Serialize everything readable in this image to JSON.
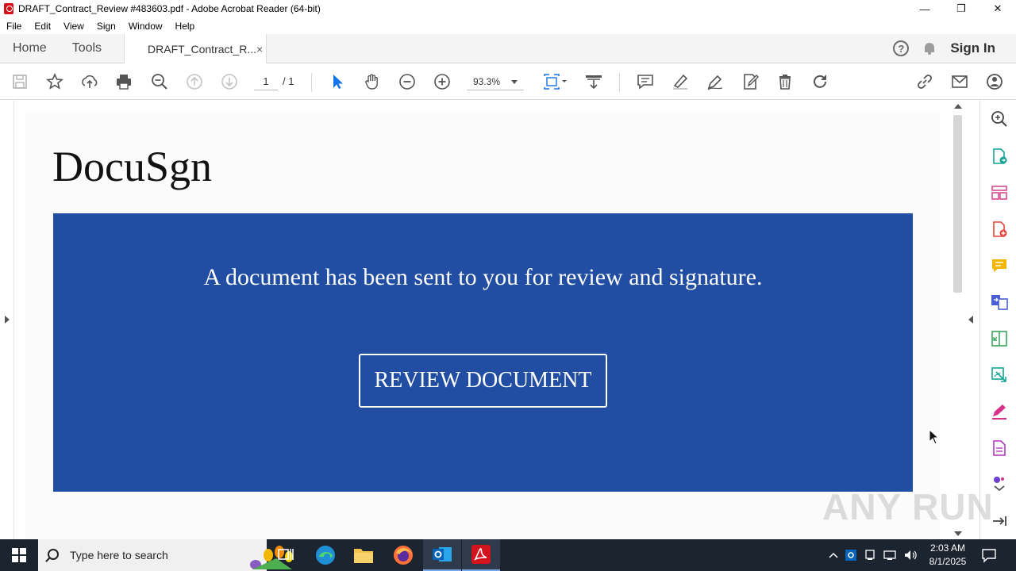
{
  "window": {
    "title": "DRAFT_Contract_Review #483603.pdf - Adobe Acrobat Reader (64-bit)",
    "minimize": "—",
    "maximize": "❐",
    "close": "✕"
  },
  "menu": [
    "File",
    "Edit",
    "View",
    "Sign",
    "Window",
    "Help"
  ],
  "tabs": {
    "home": "Home",
    "tools": "Tools",
    "doc": "DRAFT_Contract_R...",
    "doc_close": "×",
    "help": "?",
    "signin": "Sign In"
  },
  "toolbar": {
    "page_current": "1",
    "page_total": "/ 1",
    "zoom": "93.3%"
  },
  "document": {
    "brand": "DocuSgn",
    "message": "A document has been sent to you for review and signature.",
    "button": "REVIEW DOCUMENT",
    "banner_color": "#214ea2"
  },
  "watermark": "ANY RUN",
  "taskbar": {
    "search_placeholder": "Type here to search",
    "time": "2:03 AM",
    "date": "8/1/2025"
  },
  "icons": {
    "toolbar": [
      "save-icon",
      "bookmark-star-icon",
      "upload-icon",
      "print-icon",
      "zoom-search-icon",
      "prev-page-icon",
      "next-page-icon",
      "select-arrow-icon",
      "hand-icon",
      "zoom-out-icon",
      "zoom-in-icon",
      "fit-page-icon",
      "scroll-mode-icon",
      "comment-icon",
      "highlight-icon",
      "sign-pen-icon",
      "edit-icon",
      "delete-icon",
      "rotate-icon",
      "link-icon",
      "mail-icon",
      "share-user-icon"
    ],
    "right_panel": [
      "search-zoom-icon",
      "export-pdf-icon",
      "organize-pages-icon",
      "create-pdf-icon",
      "comment-icon",
      "combine-files-icon",
      "compress-icon",
      "scan-icon",
      "fill-sign-icon",
      "document-icon",
      "more-icon"
    ]
  }
}
